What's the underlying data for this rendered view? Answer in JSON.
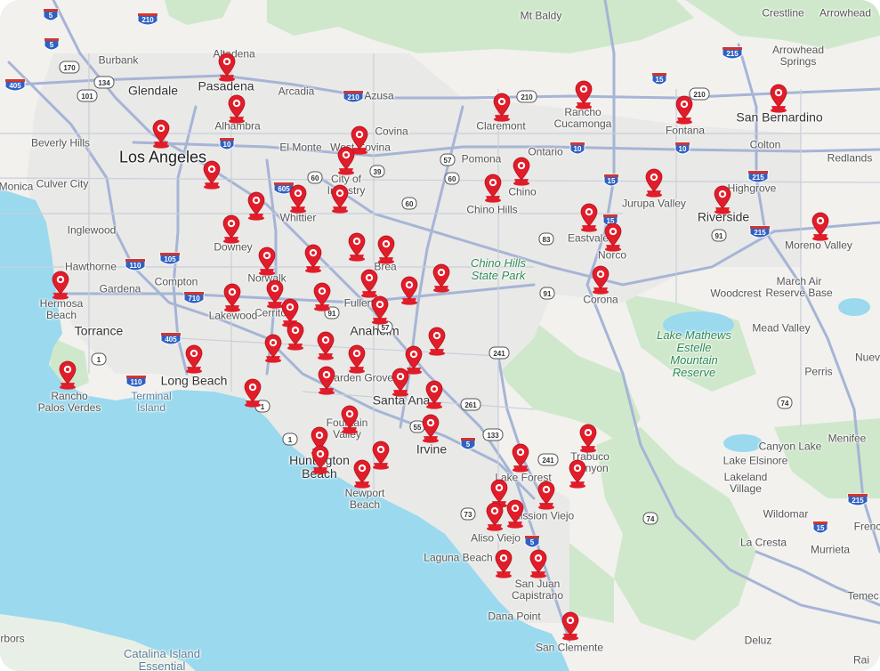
{
  "colors": {
    "ocean": "#9ad9ee",
    "land": "#f2f1ee",
    "park": "#c8e6c3",
    "urban": "#e8e8e6",
    "highway": "#a6b4d6",
    "marker": "#e11d2a"
  },
  "map": {
    "places": [
      {
        "id": "altadena",
        "text": "Altadena",
        "cls": "city"
      },
      {
        "id": "mt-baldy",
        "text": "Mt Baldy",
        "cls": "city"
      },
      {
        "id": "crestline",
        "text": "Crestline",
        "cls": "city"
      },
      {
        "id": "arrowhead",
        "text": "Arrowhead",
        "cls": "city"
      },
      {
        "id": "burbank",
        "text": "Burbank",
        "cls": "city"
      },
      {
        "id": "glendale",
        "text": "Glendale",
        "cls": "major"
      },
      {
        "id": "pasadena",
        "text": "Pasadena",
        "cls": "major"
      },
      {
        "id": "arrowhead-springs",
        "text": "Arrowhead\nSprings",
        "cls": "city"
      },
      {
        "id": "arcadia",
        "text": "Arcadia",
        "cls": "city"
      },
      {
        "id": "azusa",
        "text": "Azusa",
        "cls": "city"
      },
      {
        "id": "alhambra",
        "text": "Alhambra",
        "cls": "city"
      },
      {
        "id": "claremont",
        "text": "Claremont",
        "cls": "city"
      },
      {
        "id": "rancho-cucamonga",
        "text": "Rancho\nCucamonga",
        "cls": "city"
      },
      {
        "id": "fontana",
        "text": "Fontana",
        "cls": "city"
      },
      {
        "id": "san-bernardino",
        "text": "San Bernardino",
        "cls": "major"
      },
      {
        "id": "covina",
        "text": "Covina",
        "cls": "city"
      },
      {
        "id": "beverly-hills",
        "text": "Beverly Hills",
        "cls": "city"
      },
      {
        "id": "el-monte",
        "text": "El Monte",
        "cls": "city"
      },
      {
        "id": "west-covina",
        "text": "West Covina",
        "cls": "city"
      },
      {
        "id": "los-angeles",
        "text": "Los Angeles",
        "cls": "big"
      },
      {
        "id": "pomona",
        "text": "Pomona",
        "cls": "city"
      },
      {
        "id": "ontario",
        "text": "Ontario",
        "cls": "city"
      },
      {
        "id": "colton",
        "text": "Colton",
        "cls": "city"
      },
      {
        "id": "redlands",
        "text": "Redlands",
        "cls": "city"
      },
      {
        "id": "city-of-industry",
        "text": "City of\nIndustry",
        "cls": "city"
      },
      {
        "id": "santa-monica",
        "text": "Monica",
        "cls": "city"
      },
      {
        "id": "culver-city",
        "text": "Culver City",
        "cls": "city"
      },
      {
        "id": "chino",
        "text": "Chino",
        "cls": "city"
      },
      {
        "id": "chino-hills",
        "text": "Chino Hills",
        "cls": "city"
      },
      {
        "id": "jurupa-valley",
        "text": "Jurupa Valley",
        "cls": "city"
      },
      {
        "id": "highgrove",
        "text": "Highgrove",
        "cls": "city"
      },
      {
        "id": "whittier",
        "text": "Whittier",
        "cls": "city"
      },
      {
        "id": "riverside",
        "text": "Riverside",
        "cls": "major"
      },
      {
        "id": "inglewood",
        "text": "Inglewood",
        "cls": "city"
      },
      {
        "id": "downey",
        "text": "Downey",
        "cls": "city"
      },
      {
        "id": "eastvale",
        "text": "Eastvale",
        "cls": "city"
      },
      {
        "id": "moreno-valley",
        "text": "Moreno Valley",
        "cls": "city"
      },
      {
        "id": "norco",
        "text": "Norco",
        "cls": "city"
      },
      {
        "id": "hawthorne",
        "text": "Hawthorne",
        "cls": "city"
      },
      {
        "id": "norwalk",
        "text": "Norwalk",
        "cls": "city"
      },
      {
        "id": "brea",
        "text": "Brea",
        "cls": "city"
      },
      {
        "id": "chino-hills-sp",
        "text": "Chino Hills\nState Park",
        "cls": "park"
      },
      {
        "id": "gardena",
        "text": "Gardena",
        "cls": "city"
      },
      {
        "id": "compton",
        "text": "Compton",
        "cls": "city"
      },
      {
        "id": "march-air-reserve",
        "text": "March Air\nReserve Base",
        "cls": "city"
      },
      {
        "id": "hermosa-beach",
        "text": "Hermosa\nBeach",
        "cls": "city"
      },
      {
        "id": "cerritos",
        "text": "Cerritos",
        "cls": "city"
      },
      {
        "id": "fullerton",
        "text": "Fullerton",
        "cls": "city"
      },
      {
        "id": "corona",
        "text": "Corona",
        "cls": "city"
      },
      {
        "id": "woodcrest",
        "text": "Woodcrest",
        "cls": "city"
      },
      {
        "id": "lakewood",
        "text": "Lakewood",
        "cls": "city"
      },
      {
        "id": "torrance",
        "text": "Torrance",
        "cls": "major"
      },
      {
        "id": "anaheim",
        "text": "Anaheim",
        "cls": "major"
      },
      {
        "id": "mead-valley",
        "text": "Mead Valley",
        "cls": "city"
      },
      {
        "id": "lake-mathews",
        "text": "Lake Mathews\nEstelle\nMountain\nReserve",
        "cls": "park"
      },
      {
        "id": "nuevo",
        "text": "Nuev",
        "cls": "city"
      },
      {
        "id": "rancho-palos-verdes",
        "text": "Rancho\nPalos Verdes",
        "cls": "city"
      },
      {
        "id": "long-beach",
        "text": "Long Beach",
        "cls": "major"
      },
      {
        "id": "garden-grove",
        "text": "Garden Grove",
        "cls": "city"
      },
      {
        "id": "perris",
        "text": "Perris",
        "cls": "city"
      },
      {
        "id": "terminal-island",
        "text": "Terminal\nIsland",
        "cls": "water"
      },
      {
        "id": "santa-ana",
        "text": "Santa Ana",
        "cls": "major"
      },
      {
        "id": "fountain-valley",
        "text": "Fountain\nValley",
        "cls": "city"
      },
      {
        "id": "menifee",
        "text": "Menifee",
        "cls": "city"
      },
      {
        "id": "canyon-lake",
        "text": "Canyon Lake",
        "cls": "city"
      },
      {
        "id": "irvine",
        "text": "Irvine",
        "cls": "major"
      },
      {
        "id": "huntington-beach",
        "text": "Huntington\nBeach",
        "cls": "major"
      },
      {
        "id": "trabuco-canyon",
        "text": "Trabuco\nCanyon",
        "cls": "city"
      },
      {
        "id": "lake-elsinore",
        "text": "Lake Elsinore",
        "cls": "city"
      },
      {
        "id": "lake-forest",
        "text": "Lake Forest",
        "cls": "city"
      },
      {
        "id": "lakeland-village",
        "text": "Lakeland\nVillage",
        "cls": "city"
      },
      {
        "id": "newport-beach",
        "text": "Newport\nBeach",
        "cls": "city"
      },
      {
        "id": "mission-viejo",
        "text": "Mission Viejo",
        "cls": "city"
      },
      {
        "id": "wildomar",
        "text": "Wildomar",
        "cls": "city"
      },
      {
        "id": "french-valley",
        "text": "Frenc",
        "cls": "city"
      },
      {
        "id": "aliso-viejo",
        "text": "Aliso Viejo",
        "cls": "city"
      },
      {
        "id": "la-cresta",
        "text": "La Cresta",
        "cls": "city"
      },
      {
        "id": "murrieta",
        "text": "Murrieta",
        "cls": "city"
      },
      {
        "id": "laguna-beach",
        "text": "Laguna Beach",
        "cls": "city"
      },
      {
        "id": "san-juan-capistrano",
        "text": "San Juan\nCapistrano",
        "cls": "city"
      },
      {
        "id": "temecula",
        "text": "Temec",
        "cls": "city"
      },
      {
        "id": "dana-point",
        "text": "Dana Point",
        "cls": "city"
      },
      {
        "id": "harbors",
        "text": "rbors",
        "cls": "city"
      },
      {
        "id": "san-clemente",
        "text": "San Clemente",
        "cls": "city"
      },
      {
        "id": "catalina-island",
        "text": "Catalina Island\nEssential",
        "cls": "waterbig"
      },
      {
        "id": "deluz",
        "text": "Deluz",
        "cls": "city"
      },
      {
        "id": "rainbow",
        "text": "Rai",
        "cls": "city"
      }
    ],
    "route_shields": [
      "5",
      "210",
      "5",
      "170",
      "134",
      "405",
      "101",
      "210",
      "10",
      "110",
      "105",
      "710",
      "405",
      "110",
      "1",
      "605",
      "60",
      "39",
      "57",
      "60",
      "10",
      "60",
      "15",
      "15",
      "215",
      "210",
      "210",
      "10",
      "15",
      "215",
      "91",
      "215",
      "83",
      "91",
      "91",
      "241",
      "57",
      "55",
      "5",
      "261",
      "133",
      "241",
      "73",
      "5",
      "74",
      "74",
      "215",
      "15",
      "1",
      "1"
    ],
    "location_markers": [
      "marker-1",
      "marker-2",
      "marker-3",
      "marker-4",
      "marker-5",
      "marker-6",
      "marker-7",
      "marker-8",
      "marker-9",
      "marker-10",
      "marker-11",
      "marker-12",
      "marker-13",
      "marker-14",
      "marker-15",
      "marker-16",
      "marker-17",
      "marker-18",
      "marker-19",
      "marker-20",
      "marker-21",
      "marker-22",
      "marker-23",
      "marker-24",
      "marker-25",
      "marker-26",
      "marker-27",
      "marker-28",
      "marker-29",
      "marker-30",
      "marker-31",
      "marker-32",
      "marker-33",
      "marker-34",
      "marker-35",
      "marker-36",
      "marker-37",
      "marker-38",
      "marker-39",
      "marker-40",
      "marker-41",
      "marker-42",
      "marker-43",
      "marker-44",
      "marker-45",
      "marker-46",
      "marker-47",
      "marker-48",
      "marker-49",
      "marker-50",
      "marker-51",
      "marker-52",
      "marker-53",
      "marker-54",
      "marker-55",
      "marker-56",
      "marker-57",
      "marker-58",
      "marker-59",
      "marker-60",
      "marker-61",
      "marker-62",
      "marker-63",
      "marker-64",
      "marker-65",
      "marker-66",
      "marker-67",
      "marker-68",
      "marker-69",
      "marker-70",
      "marker-71",
      "marker-72",
      "marker-73"
    ]
  }
}
